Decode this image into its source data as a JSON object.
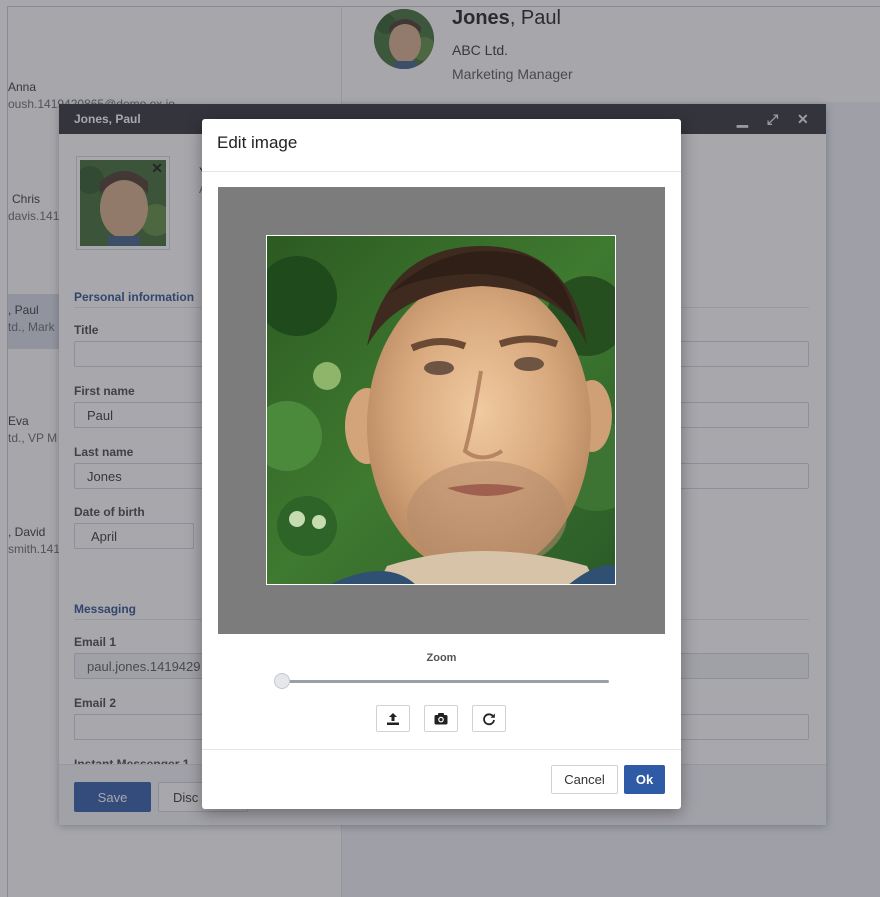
{
  "contacts": [
    {
      "name": "Anna",
      "sub": "oush.1419420865@demo.ox.io"
    },
    {
      "name": "Chris",
      "sub": "davis.1419"
    },
    {
      "name": ", Paul",
      "sub": "td., Mark"
    },
    {
      "name": "Eva",
      "sub": "td., VP M"
    },
    {
      "name": ", David",
      "sub": "smith.141"
    }
  ],
  "detail": {
    "last_name": "Jones",
    "first_name": ", Paul",
    "company": "ABC Ltd.",
    "position": "Marketing Manager"
  },
  "edit_window": {
    "title": "Jones, Paul",
    "controls": {
      "minimize": "▁",
      "maximize": "⤢",
      "close": "✕"
    },
    "photo_remove": "✕",
    "header_partial_1": "Y",
    "header_partial_2": "A",
    "sections": {
      "personal": "Personal information",
      "messaging": "Messaging"
    },
    "fields": {
      "title_label": "Title",
      "title_value": "",
      "first_name_label": "First name",
      "first_name_value": "Paul",
      "last_name_label": "Last name",
      "last_name_value": "Jones",
      "dob_label": "Date of birth",
      "dob_value": "April",
      "email1_label": "Email 1",
      "email1_value": "paul.jones.1419429",
      "email2_label": "Email 2",
      "email2_value": "",
      "im1_label": "Instant Messenger 1"
    },
    "footer": {
      "save": "Save",
      "discard": "Disc"
    }
  },
  "modal": {
    "title": "Edit image",
    "zoom_label": "Zoom",
    "zoom_value": 0,
    "tools": [
      "upload-icon",
      "camera-icon",
      "rotate-icon"
    ],
    "cancel": "Cancel",
    "ok": "Ok"
  },
  "colors": {
    "primary": "#2f5aa6",
    "titlebar": "#2e2f33",
    "section": "#2a4f8a",
    "crop_bg": "#7c7c7c"
  }
}
